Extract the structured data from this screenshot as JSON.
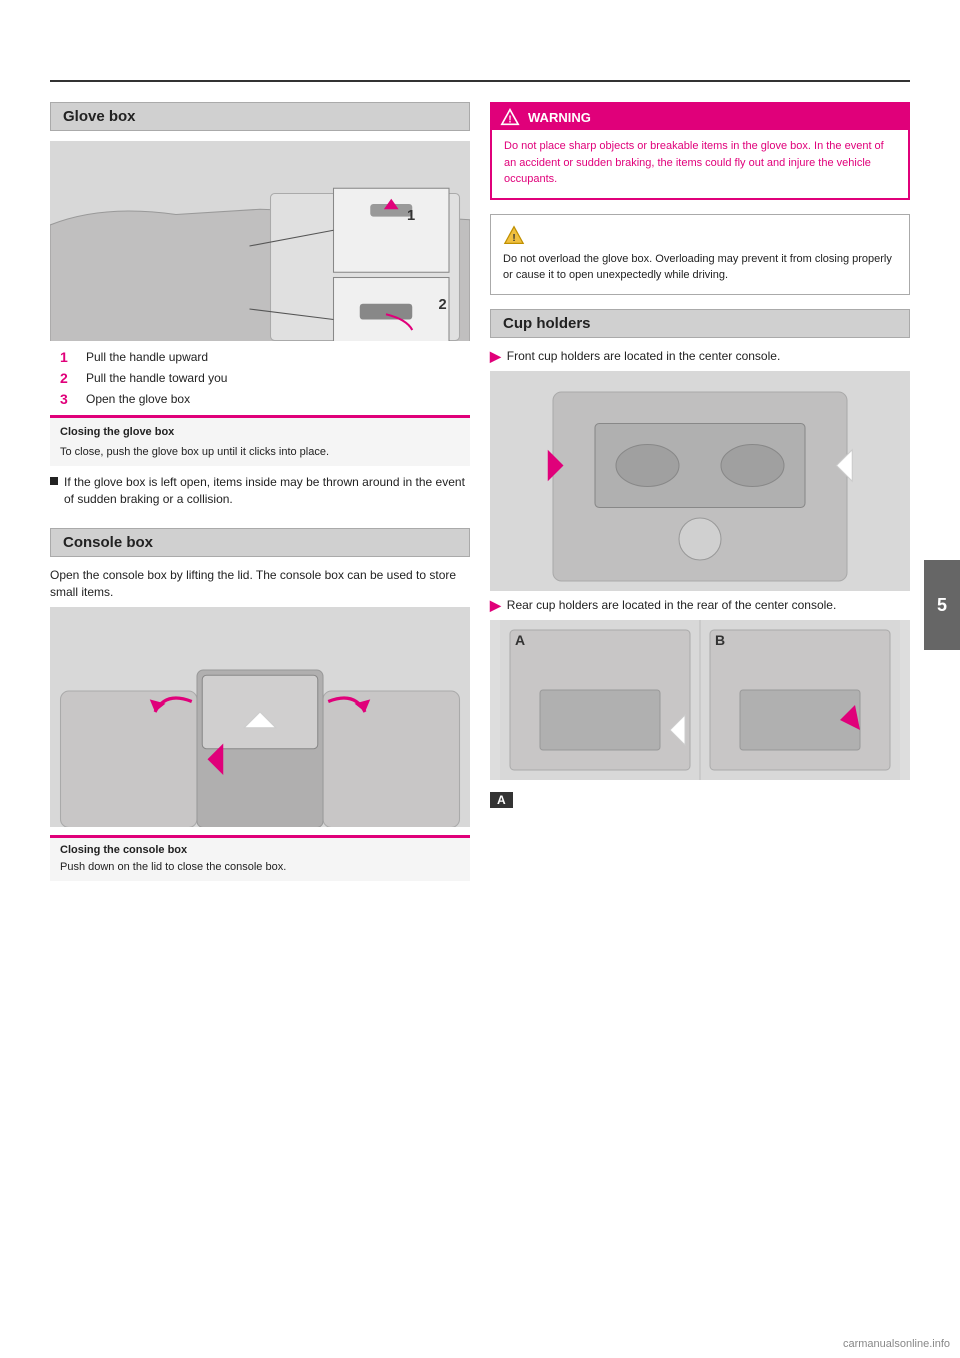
{
  "page": {
    "section_number": "5",
    "top_rule": true
  },
  "glove_box": {
    "title": "Glove box",
    "steps": [
      {
        "number": "1",
        "text": "Pull the handle upward"
      },
      {
        "number": "2",
        "text": "Pull the handle toward you"
      },
      {
        "number": "3",
        "text": "Open the glove box"
      }
    ],
    "note_title": "Closing the glove box",
    "note_text": "To close, push the glove box up until it clicks into place.",
    "extra_bullet": "If the glove box is left open, items inside may be thrown around in the event of sudden braking or a collision."
  },
  "warning": {
    "title": "WARNING",
    "text": "Do not place sharp objects or breakable items in the glove box. In the event of an accident or sudden braking, the items could fly out and injure the vehicle occupants."
  },
  "caution": {
    "text": "Do not overload the glove box. Overloading may prevent it from closing properly or cause it to open unexpectedly while driving."
  },
  "console_box": {
    "title": "Console box",
    "text": "Open the console box by lifting the lid. The console box can be used to store small items.",
    "note_title": "Closing the console box",
    "note_text": "Push down on the lid to close the console box."
  },
  "cup_holders": {
    "title": "Cup holders",
    "arrow_text1": "Front cup holders are located in the center console.",
    "arrow_text2": "Rear cup holders are located in the rear of the center console.",
    "label_a": "A",
    "label_b": "B",
    "label_a_bottom": "A"
  },
  "watermark": "carmanualsonline.info"
}
